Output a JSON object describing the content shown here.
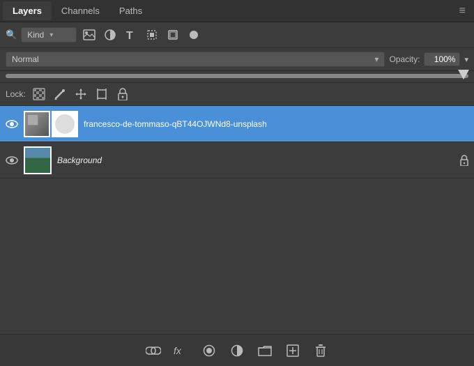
{
  "tabs": [
    {
      "label": "Layers",
      "active": true
    },
    {
      "label": "Channels",
      "active": false
    },
    {
      "label": "Paths",
      "active": false
    }
  ],
  "filter": {
    "kind_label": "Kind",
    "icons": [
      "image-icon",
      "circle-half-icon",
      "text-icon",
      "transform-icon",
      "adjustment-icon",
      "circle-icon"
    ]
  },
  "blend": {
    "mode": "Normal",
    "opacity_label": "Opacity:",
    "opacity_value": "100%"
  },
  "lock": {
    "label": "Lock:",
    "icons": [
      "lock-transparent-icon",
      "lock-pixel-icon",
      "lock-move-icon",
      "lock-artboard-icon",
      "lock-all-icon"
    ]
  },
  "layers": [
    {
      "name": "francesco-de-tommaso-qBT44OJWNd8-unsplash",
      "visible": true,
      "selected": true,
      "has_mask": true,
      "type": "image"
    },
    {
      "name": "Background",
      "visible": true,
      "selected": false,
      "has_mask": false,
      "type": "background",
      "locked": true
    }
  ],
  "bottom_toolbar": {
    "icons": [
      "link-icon",
      "fx-icon",
      "fill-icon",
      "adjustment-icon",
      "folder-icon",
      "new-layer-icon",
      "delete-icon"
    ]
  },
  "menu_icon": "≡"
}
